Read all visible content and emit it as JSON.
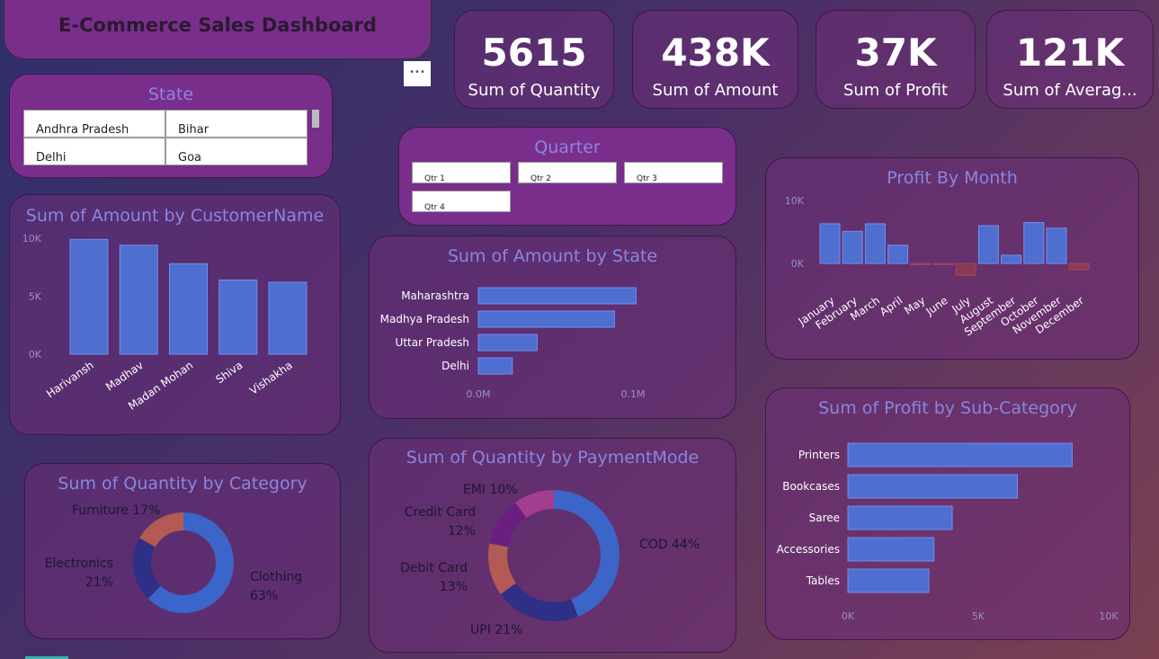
{
  "header": {
    "title": "E-Commerce Sales Dashboard",
    "more_label": "•••"
  },
  "kpis": [
    {
      "value": "5615",
      "label": "Sum of Quantity"
    },
    {
      "value": "438K",
      "label": "Sum of Amount"
    },
    {
      "value": "37K",
      "label": "Sum of Profit"
    },
    {
      "value": "121K",
      "label": "Sum of Averag..."
    }
  ],
  "state_slicer": {
    "title": "State",
    "items": [
      "Andhra Pradesh",
      "Bihar",
      "Delhi",
      "Goa"
    ]
  },
  "quarter_slicer": {
    "title": "Quarter",
    "items": [
      "Qtr 1",
      "Qtr 2",
      "Qtr 3",
      "Qtr 4"
    ]
  },
  "colors": {
    "bar": "#4e6fd0",
    "bar_negative": "#8a3a55",
    "axis_text": "#9a8fc8",
    "title": "#8a86e0"
  },
  "chart_data": [
    {
      "id": "amount_by_customer",
      "type": "bar",
      "title": "Sum of Amount by CustomerName",
      "categories": [
        "Harivansh",
        "Madhav",
        "Madan Mohan",
        "Shiva",
        "Vishakha"
      ],
      "values": [
        9900,
        9400,
        7800,
        6400,
        6200
      ],
      "ylim": [
        0,
        10000
      ],
      "yticks": [
        "0K",
        "5K",
        "10K"
      ],
      "grid": false
    },
    {
      "id": "amount_by_state",
      "type": "bar",
      "orientation": "horizontal",
      "title": "Sum of Amount by State",
      "categories": [
        "Maharashtra",
        "Madhya Pradesh",
        "Uttar Pradesh",
        "Delhi"
      ],
      "values": [
        102000,
        88000,
        38000,
        22000
      ],
      "xlim": [
        0,
        100000
      ],
      "xticks": [
        "0.0M",
        "0.1M"
      ],
      "grid": false
    },
    {
      "id": "profit_by_month",
      "type": "bar",
      "title": "Profit By Month",
      "categories": [
        "January",
        "February",
        "March",
        "April",
        "May",
        "June",
        "July",
        "August",
        "September",
        "October",
        "November",
        "December"
      ],
      "values": [
        6300,
        5100,
        6300,
        2900,
        -200,
        -100,
        -1900,
        6000,
        1300,
        6500,
        5600,
        -1000
      ],
      "ylim": [
        -2000,
        10000
      ],
      "yticks": [
        "0K",
        "10K"
      ],
      "grid": false
    },
    {
      "id": "profit_by_subcategory",
      "type": "bar",
      "orientation": "horizontal",
      "title": "Sum of Profit by Sub-Category",
      "categories": [
        "Printers",
        "Bookcases",
        "Saree",
        "Accessories",
        "Tables"
      ],
      "values": [
        8600,
        6500,
        4000,
        3300,
        3100
      ],
      "xlim": [
        0,
        10000
      ],
      "xticks": [
        "0K",
        "5K",
        "10K"
      ],
      "grid": false
    },
    {
      "id": "quantity_by_category",
      "type": "pie",
      "donut": true,
      "title": "Sum of Quantity by Category",
      "slices": [
        {
          "label": "Clothing",
          "pct": "63%",
          "value": 63,
          "color": "#3b65c8"
        },
        {
          "label": "Electronics",
          "pct": "21%",
          "value": 21,
          "color": "#2e2f86"
        },
        {
          "label": "Furniture",
          "pct": "17%",
          "value": 17,
          "color": "#b45a55"
        }
      ]
    },
    {
      "id": "quantity_by_paymentmode",
      "type": "pie",
      "donut": true,
      "title": "Sum of Quantity by PaymentMode",
      "slices": [
        {
          "label": "COD",
          "pct": "44%",
          "value": 44,
          "color": "#3b65c8"
        },
        {
          "label": "UPI",
          "pct": "21%",
          "value": 21,
          "color": "#2e2f86"
        },
        {
          "label": "Debit Card",
          "pct": "13%",
          "value": 13,
          "color": "#b45a55"
        },
        {
          "label": "Credit Card",
          "pct": "12%",
          "value": 12,
          "color": "#6a1f80"
        },
        {
          "label": "EMI",
          "pct": "10%",
          "value": 10,
          "color": "#a33d8f"
        }
      ]
    }
  ]
}
